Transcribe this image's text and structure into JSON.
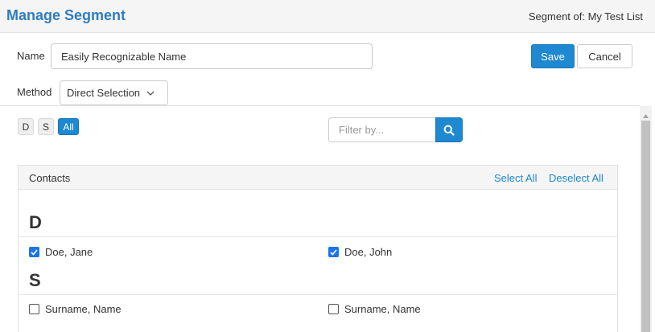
{
  "header": {
    "title": "Manage Segment",
    "segment_of": "Segment of: My Test List"
  },
  "form": {
    "name_label": "Name",
    "name_value": "Easily Recognizable Name",
    "method_label": "Method",
    "method_value": "Direct Selection",
    "save_label": "Save",
    "cancel_label": "Cancel"
  },
  "filters": {
    "letters": [
      "D",
      "S",
      "All"
    ],
    "active": "All",
    "search_placeholder": "Filter by..."
  },
  "contacts_panel": {
    "title": "Contacts",
    "select_all": "Select All",
    "deselect_all": "Deselect All",
    "groups": [
      {
        "letter": "D",
        "contacts": [
          {
            "name": "Doe, Jane",
            "checked": true
          },
          {
            "name": "Doe, John",
            "checked": true
          }
        ]
      },
      {
        "letter": "S",
        "contacts": [
          {
            "name": "Surname, Name",
            "checked": false
          },
          {
            "name": "Surname, Name",
            "checked": false
          }
        ]
      }
    ]
  },
  "colors": {
    "title_blue": "#2f7dc0",
    "primary": "#1e88d0",
    "checkbox_checked": "#1b74e8"
  },
  "icons": {
    "search": "search-icon",
    "method_dropdown": "chevron-down-icon",
    "scroll_up": "arrow-up-icon",
    "checkbox_check": "check-icon"
  }
}
